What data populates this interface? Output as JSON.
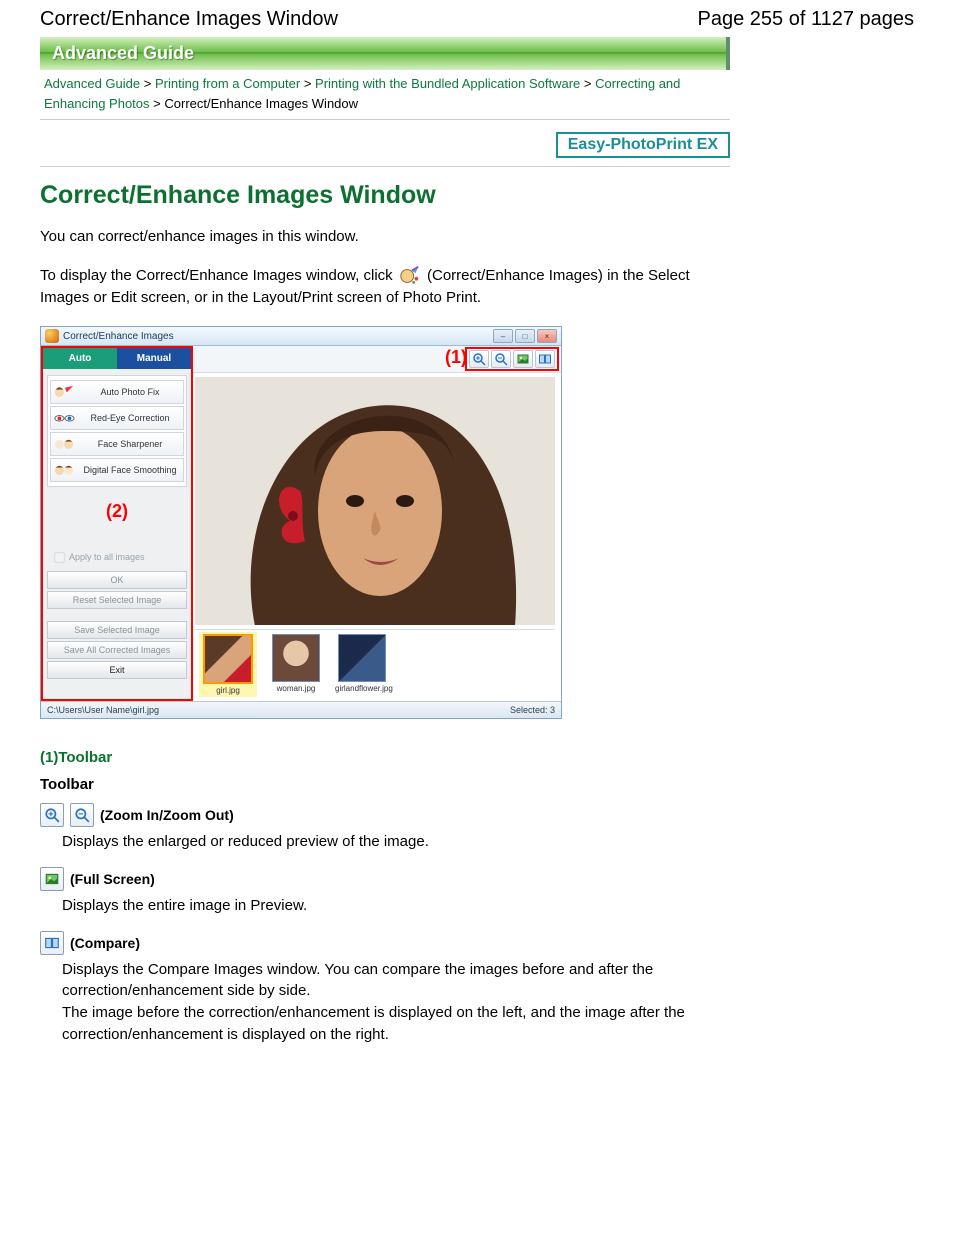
{
  "header": {
    "title": "Correct/Enhance Images Window",
    "page_indicator": "Page 255 of 1127 pages"
  },
  "banner": "Advanced Guide",
  "breadcrumb": {
    "l0": "Advanced Guide",
    "l1": "Printing from a Computer",
    "l2": "Printing with the Bundled Application Software",
    "l3": "Correcting and Enhancing Photos",
    "l4": "Correct/Enhance Images Window"
  },
  "app_badge": "Easy-PhotoPrint EX",
  "page_title": "Correct/Enhance Images Window",
  "intro": "You can correct/enhance images in this window.",
  "howto_pre": "To display the Correct/Enhance Images window, click",
  "howto_post": "(Correct/Enhance Images) in the Select Images or Edit screen, or in the Layout/Print screen of Photo Print.",
  "window": {
    "title": "Correct/Enhance Images",
    "annot1": "(1)",
    "annot2": "(2)",
    "tabs": {
      "auto": "Auto",
      "manual": "Manual"
    },
    "side_buttons": {
      "auto_photo_fix": "Auto Photo Fix",
      "red_eye": "Red-Eye Correction",
      "face_sharpener": "Face Sharpener",
      "face_smoothing": "Digital Face Smoothing"
    },
    "apply_all": "Apply to all images",
    "ok": "OK",
    "reset": "Reset Selected Image",
    "save": "Save Selected Image",
    "save_all": "Save All Corrected Images",
    "exit": "Exit",
    "thumbs": {
      "t1": "girl.jpg",
      "t2": "woman.jpg",
      "t3": "girlandflower.jpg"
    },
    "status_path": "C:\\Users\\User Name\\girl.jpg",
    "status_sel": "Selected: 3"
  },
  "sections": {
    "toolbar_anchor": "(1)Toolbar",
    "toolbar_heading": "Toolbar",
    "zoom": {
      "title": "(Zoom In/Zoom Out)",
      "desc": "Displays the enlarged or reduced preview of the image."
    },
    "full": {
      "title": "(Full Screen)",
      "desc": "Displays the entire image in Preview."
    },
    "compare": {
      "title": "(Compare)",
      "desc1": "Displays the Compare Images window. You can compare the images before and after the correction/enhancement side by side.",
      "desc2": "The image before the correction/enhancement is displayed on the left, and the image after the correction/enhancement is displayed on the right."
    }
  }
}
